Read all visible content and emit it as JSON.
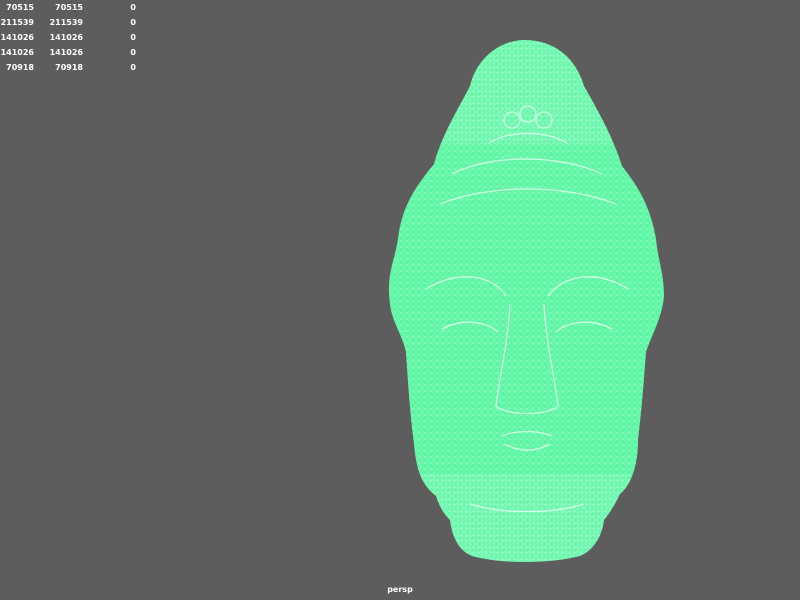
{
  "hud": {
    "rows": [
      {
        "a": "70515",
        "b": "70515",
        "c": "0"
      },
      {
        "a": "211539",
        "b": "211539",
        "c": "0"
      },
      {
        "a": "141026",
        "b": "141026",
        "c": "0"
      },
      {
        "a": "141026",
        "b": "141026",
        "c": "0"
      },
      {
        "a": "70918",
        "b": "70918",
        "c": "0"
      }
    ]
  },
  "viewport": {
    "camera": "persp",
    "background_color": "#5d5d5d",
    "mesh_color": "#5cf5a4",
    "wire_color": "#dffff0"
  }
}
